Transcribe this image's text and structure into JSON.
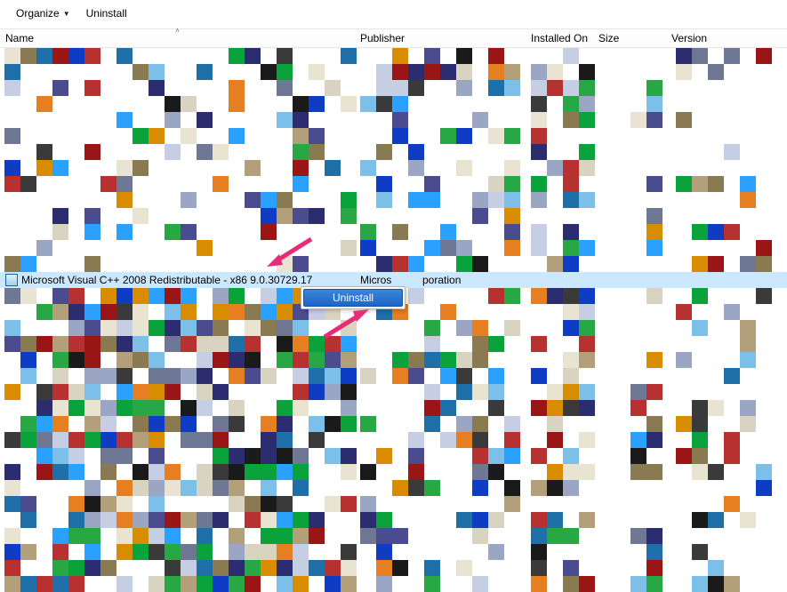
{
  "toolbar": {
    "organize_label": "Organize",
    "uninstall_label": "Uninstall"
  },
  "columns": {
    "name": "Name",
    "publisher": "Publisher",
    "installed_on": "Installed On",
    "size": "Size",
    "version": "Version",
    "sorted_column": "name",
    "sort_direction": "asc"
  },
  "selected_row": {
    "name": "Microsoft Visual C++ 2008 Redistributable - x86 9.0.30729.17",
    "publisher_prefix": "Micros",
    "publisher_suffix": "poration"
  },
  "context_menu": {
    "uninstall_label": "Uninstall"
  },
  "arrow_color": "#e62d78",
  "mosaic": {
    "note": "background content is pixelated/obscured; actual program names not visible"
  }
}
